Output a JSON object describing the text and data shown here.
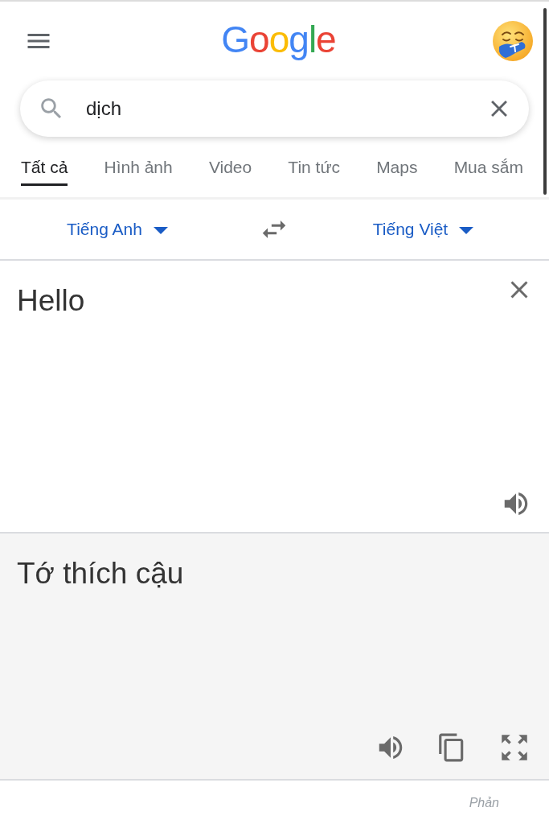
{
  "header": {
    "logo": "Google"
  },
  "search": {
    "value": "dịch"
  },
  "tabs": [
    {
      "label": "Tất cả",
      "selected": true
    },
    {
      "label": "Hình ảnh",
      "selected": false
    },
    {
      "label": "Video",
      "selected": false
    },
    {
      "label": "Tin tức",
      "selected": false
    },
    {
      "label": "Maps",
      "selected": false
    },
    {
      "label": "Mua sắm",
      "selected": false
    }
  ],
  "translator": {
    "source_language": "Tiếng Anh",
    "target_language": "Tiếng Việt",
    "source_text": "Hello",
    "translation": "Tớ thích cậu"
  },
  "footer": {
    "link": "Phản"
  }
}
